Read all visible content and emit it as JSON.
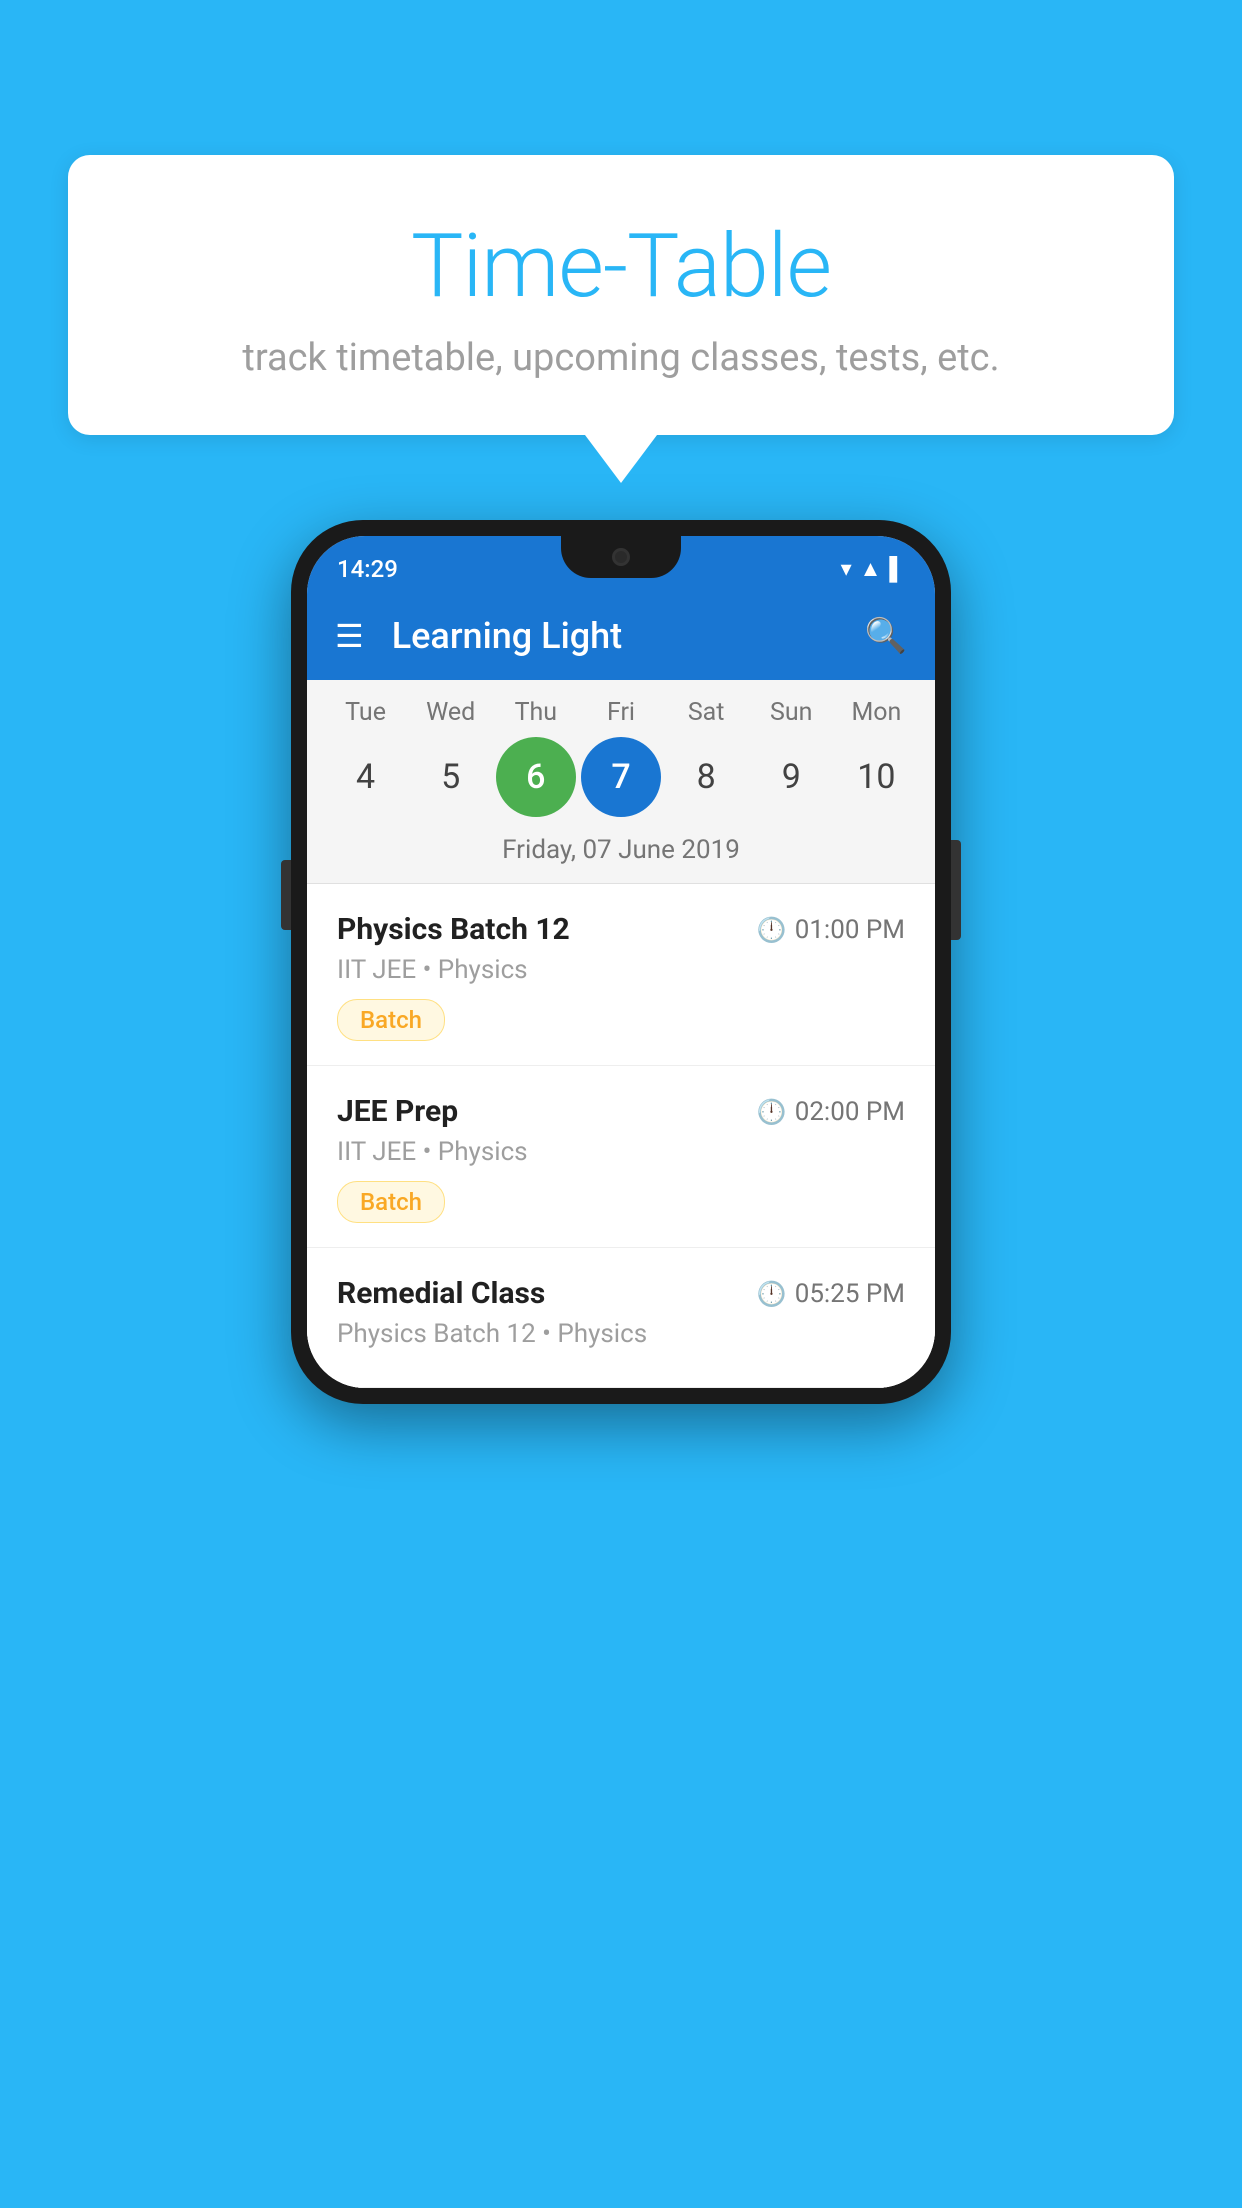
{
  "background_color": "#29B6F6",
  "speech_bubble": {
    "title": "Time-Table",
    "subtitle": "track timetable, upcoming classes, tests, etc."
  },
  "phone": {
    "status_bar": {
      "time": "14:29",
      "icons": [
        "▼",
        "▲",
        "▌"
      ]
    },
    "app_bar": {
      "title": "Learning Light"
    },
    "calendar": {
      "days": [
        {
          "label": "Tue",
          "number": "4"
        },
        {
          "label": "Wed",
          "number": "5"
        },
        {
          "label": "Thu",
          "number": "6",
          "state": "today"
        },
        {
          "label": "Fri",
          "number": "7",
          "state": "selected"
        },
        {
          "label": "Sat",
          "number": "8"
        },
        {
          "label": "Sun",
          "number": "9"
        },
        {
          "label": "Mon",
          "number": "10"
        }
      ],
      "selected_date_label": "Friday, 07 June 2019"
    },
    "schedule": [
      {
        "title": "Physics Batch 12",
        "time": "01:00 PM",
        "subtitle": "IIT JEE • Physics",
        "badge": "Batch"
      },
      {
        "title": "JEE Prep",
        "time": "02:00 PM",
        "subtitle": "IIT JEE • Physics",
        "badge": "Batch"
      },
      {
        "title": "Remedial Class",
        "time": "05:25 PM",
        "subtitle": "Physics Batch 12 • Physics",
        "badge": null
      }
    ]
  }
}
